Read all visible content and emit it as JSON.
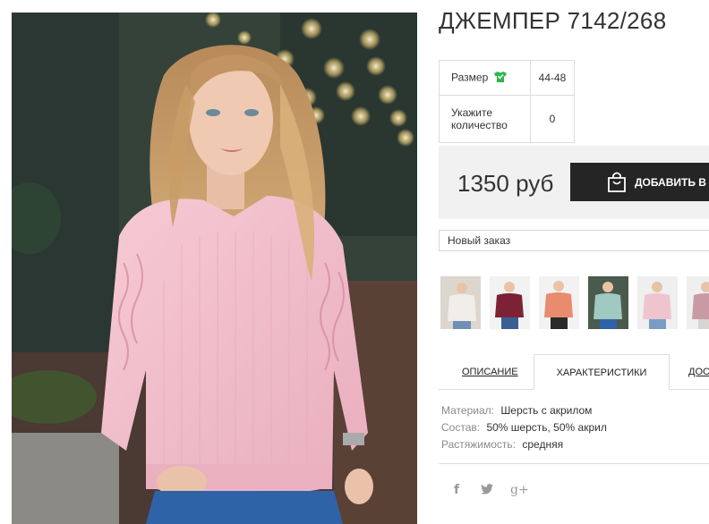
{
  "product": {
    "title": "ДЖЕМПЕР 7142/268",
    "price": "1350 руб"
  },
  "options": {
    "size_label": "Размер",
    "size_icon": "tshirt-icon",
    "size_value": "44-48",
    "qty_label_line1": "Укажите",
    "qty_label_line2": "количество",
    "qty_value": "0"
  },
  "cart": {
    "button_label": "ДОБАВИТЬ В ЗАКАЗ",
    "icon": "shopping-bag-icon"
  },
  "order_select": {
    "value": "Новый заказ"
  },
  "tabs": [
    {
      "label": "ОПИСАНИЕ",
      "active": false
    },
    {
      "label": "ХАРАКТЕРИСТИКИ",
      "active": true
    },
    {
      "label": "ДОСТАВКА",
      "active": false
    }
  ],
  "characteristics": [
    {
      "key": "Материал:",
      "value": "Шерсть с акрилом"
    },
    {
      "key": "Состав:",
      "value": "50% шерсть, 50% акрил"
    },
    {
      "key": "Растяжимость:",
      "value": "средняя"
    }
  ],
  "social": [
    {
      "name": "facebook-icon",
      "glyph": "f"
    },
    {
      "name": "twitter-icon",
      "glyph": "🐦"
    },
    {
      "name": "google-plus-icon",
      "glyph": "g+"
    }
  ],
  "thumbnails": [
    {
      "name": "thumb-white",
      "color": "#e9e4df"
    },
    {
      "name": "thumb-burgundy",
      "color": "#7d2236"
    },
    {
      "name": "thumb-coral",
      "color": "#e98b6e"
    },
    {
      "name": "thumb-mint",
      "color": "#9fc9c1"
    },
    {
      "name": "thumb-pink",
      "color": "#eec5cf"
    },
    {
      "name": "thumb-mauve",
      "color": "#c99aa5"
    }
  ],
  "colors": {
    "accent_green": "#2bb84b",
    "button_dark": "#252525",
    "panel_gray": "#f1f1f1",
    "sweater_pink": "#f2bfcc"
  }
}
